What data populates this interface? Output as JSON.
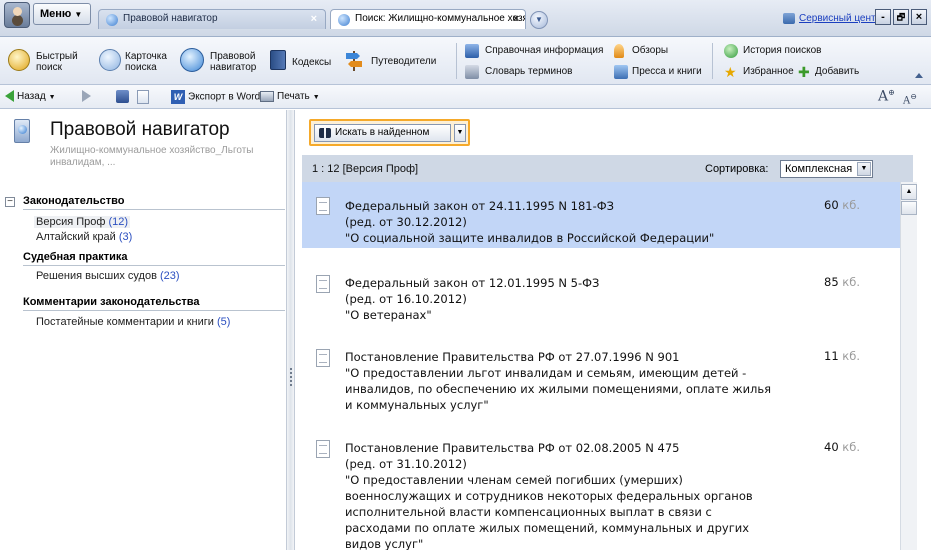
{
  "titlebar": {
    "menu_label": "Меню",
    "tabs": [
      {
        "label": "Правовой навигатор",
        "close": "×"
      },
      {
        "label": "Поиск: Жилищно-коммунальное хозя...",
        "close": "×"
      }
    ],
    "service_link": "Сервисный центр",
    "window_buttons": {
      "minimize": "-",
      "restore": "🗗",
      "close": "×"
    }
  },
  "ribbon": {
    "quick_search": "Быстрый поиск",
    "search_card": "Карточка поиска",
    "legal_navigator": "Правовой навигатор",
    "codes": "Кодексы",
    "guides": "Путеводители",
    "reference_info": "Справочная информация",
    "glossary": "Словарь терминов",
    "reviews": "Обзоры",
    "press_books": "Пресса и книги",
    "search_history": "История поисков",
    "favorites": "Избранное",
    "add": "Добавить"
  },
  "toolbar": {
    "back": "Назад",
    "export_word": "Экспорт в Word",
    "print": "Печать"
  },
  "left_panel": {
    "title": "Правовой навигатор",
    "subtitle": "Жилищно-коммунальное хозяйство_Льготы инвалидам, ...",
    "tree_toggle": "−",
    "sections": [
      {
        "title": "Законодательство",
        "items": [
          {
            "label": "Версия Проф",
            "count": "(12)"
          },
          {
            "label": "Алтайский край",
            "count": "(3)"
          }
        ]
      },
      {
        "title": "Судебная практика",
        "items": [
          {
            "label": "Решения высших судов",
            "count": "(23)"
          }
        ]
      },
      {
        "title": "Комментарии законодательства",
        "items": [
          {
            "label": "Постатейные комментарии и книги",
            "count": "(5)"
          }
        ]
      }
    ]
  },
  "right_panel": {
    "search_in_found": "Искать в найденном",
    "result_count": "1 : 12 [Версия Проф]",
    "sort_label": "Сортировка:",
    "sort_value": "Комплексная",
    "size_unit": "кб.",
    "documents": [
      {
        "lines": [
          "Федеральный закон от 24.11.1995 N 181-ФЗ",
          "(ред. от 30.12.2012)",
          "\"О социальной защите инвалидов в Российской Федерации\""
        ],
        "size": "60"
      },
      {
        "lines": [
          "Федеральный закон от 12.01.1995 N 5-ФЗ",
          "(ред. от 16.10.2012)",
          "\"О ветеранах\""
        ],
        "size": "85"
      },
      {
        "lines": [
          "Постановление Правительства РФ от 27.07.1996 N 901",
          "\"О предоставлении льгот инвалидам и семьям, имеющим детей -",
          "инвалидов, по обеспечению их жилыми помещениями, оплате жилья",
          "и коммунальных услуг\""
        ],
        "size": "11"
      },
      {
        "lines": [
          "Постановление Правительства РФ от 02.08.2005 N 475",
          "(ред. от 31.10.2012)",
          "\"О предоставлении членам семей погибших (умерших)",
          "военнослужащих и сотрудников некоторых федеральных органов",
          "исполнительной власти компенсационных выплат в связи с",
          "расходами по оплате жилых помещений, коммунальных и других",
          "видов услуг\""
        ],
        "size": "40"
      }
    ]
  },
  "colors": {
    "selected_row": "#c2d6f7",
    "highlight_border": "#f5a92a",
    "link": "#1b3fbf",
    "count": "#2b4fc0"
  }
}
